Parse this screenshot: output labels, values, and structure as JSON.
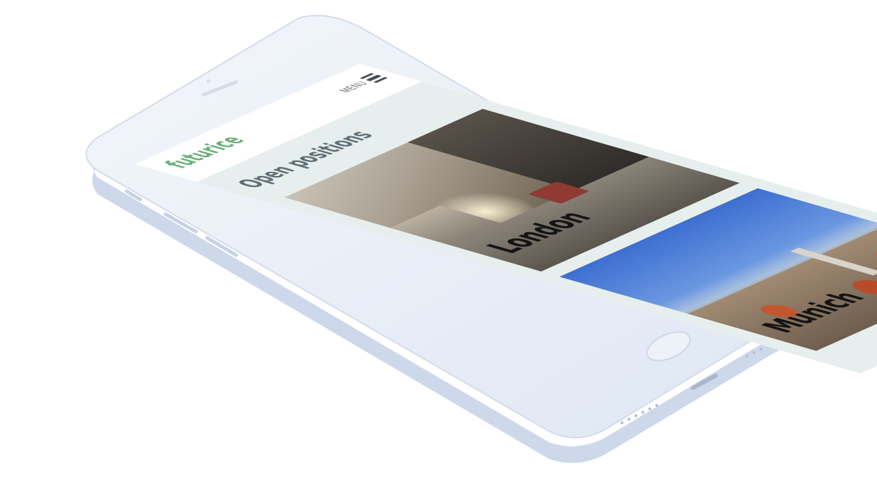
{
  "header": {
    "logo_text": "futurice",
    "menu_label": "MENU"
  },
  "main": {
    "title": "Open positions",
    "cards": [
      {
        "label": "London"
      },
      {
        "label": "Munich"
      }
    ]
  },
  "icons": {
    "menu": "hamburger-icon"
  },
  "colors": {
    "brand_green": "#6aae7a",
    "screen_background": "#e7efee",
    "title_color": "#5e6e76"
  }
}
